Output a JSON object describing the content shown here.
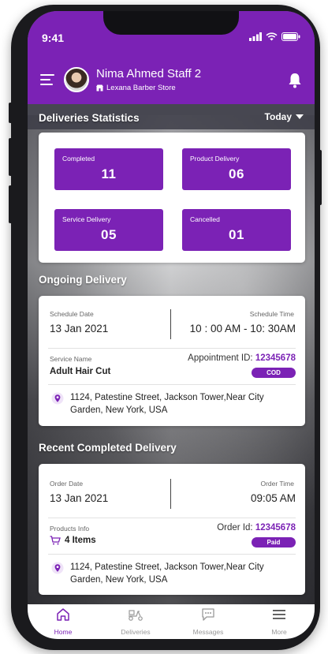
{
  "status_bar": {
    "time": "9:41"
  },
  "header": {
    "user_name": "Nima Ahmed Staff 2",
    "store_name": "Lexana Barber Store"
  },
  "stats": {
    "title": "Deliveries Statistics",
    "filter": "Today",
    "items": [
      {
        "label": "Completed",
        "value": "11"
      },
      {
        "label": "Product Delivery",
        "value": "06"
      },
      {
        "label": "Service Delivery",
        "value": "05"
      },
      {
        "label": "Cancelled",
        "value": "01"
      }
    ]
  },
  "ongoing": {
    "title": "Ongoing Delivery",
    "date_label": "Schedule Date",
    "date": "13 Jan 2021",
    "time_label": "Schedule Time",
    "time": "10 : 00 AM - 10: 30AM",
    "service_label": "Service Name",
    "service": "Adult Hair Cut",
    "id_label": "Appointment ID:",
    "id": "12345678",
    "badge": "COD",
    "address": "1124, Patestine Street, Jackson Tower,Near City Garden, New York, USA"
  },
  "recent": {
    "title": "Recent Completed Delivery",
    "date_label": "Order Date",
    "date": "13 Jan 2021",
    "time_label": "Order Time",
    "time": "09:05 AM",
    "products_label": "Products Info",
    "products": "4 Items",
    "id_label": "Order Id:",
    "id": "12345678",
    "badge": "Paid",
    "address": "1124, Patestine Street, Jackson Tower,Near City Garden, New York, USA"
  },
  "tabs": [
    {
      "label": "Home",
      "icon": "home-icon",
      "active": true
    },
    {
      "label": "Deliveries",
      "icon": "delivery-scooter-icon",
      "active": false
    },
    {
      "label": "Messages",
      "icon": "chat-icon",
      "active": false
    },
    {
      "label": "More",
      "icon": "menu-icon",
      "active": false
    }
  ],
  "colors": {
    "accent": "#7b22b5",
    "card": "#ffffff",
    "frame": "#1a1a1d"
  }
}
